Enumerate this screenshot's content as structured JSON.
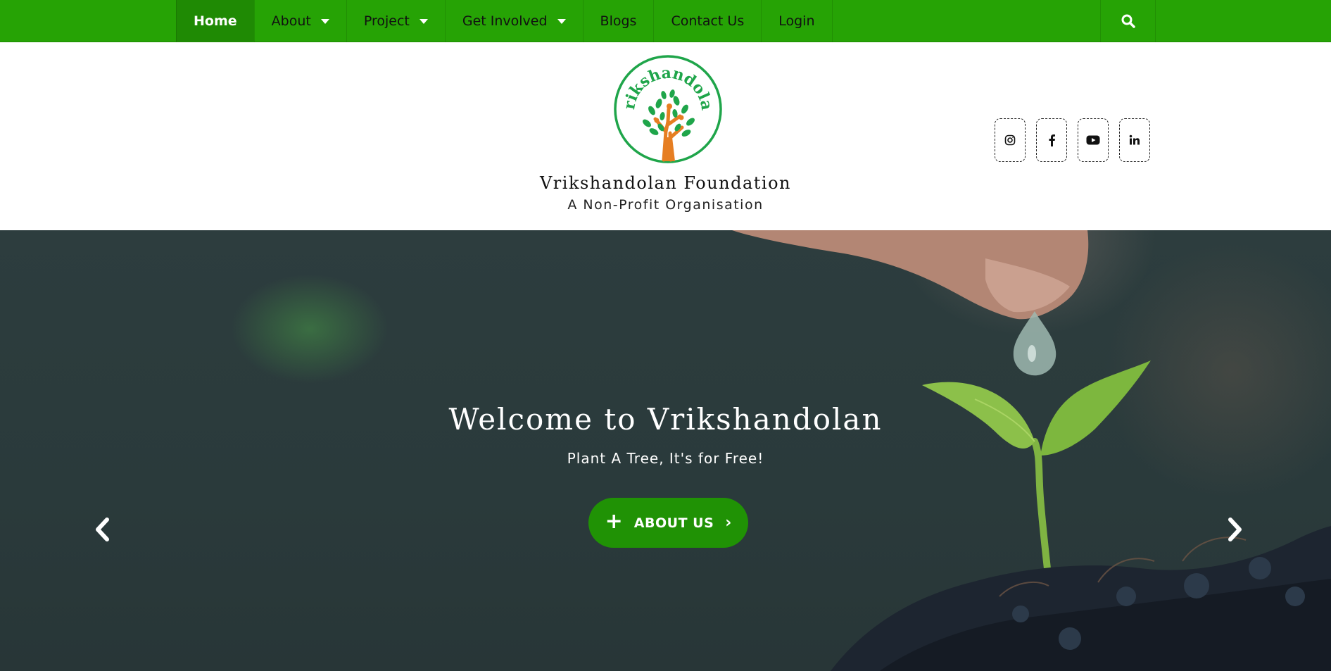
{
  "nav": {
    "items": [
      {
        "label": "Home",
        "active": true,
        "dropdown": false
      },
      {
        "label": "About",
        "active": false,
        "dropdown": true
      },
      {
        "label": "Project",
        "active": false,
        "dropdown": true
      },
      {
        "label": "Get Involved",
        "active": false,
        "dropdown": true
      },
      {
        "label": "Blogs",
        "active": false,
        "dropdown": false
      },
      {
        "label": "Contact Us",
        "active": false,
        "dropdown": false
      },
      {
        "label": "Login",
        "active": false,
        "dropdown": false
      }
    ],
    "search_icon": "search-icon"
  },
  "header": {
    "logo_text": "Vrikshandolan",
    "title": "Vrikshandolan Foundation",
    "subtitle": "A Non-Profit Organisation",
    "social": [
      {
        "icon": "instagram-icon",
        "glyph": "◎"
      },
      {
        "icon": "facebook-icon",
        "glyph": "f"
      },
      {
        "icon": "youtube-icon",
        "glyph": "▶"
      },
      {
        "icon": "linkedin-icon",
        "glyph": "in"
      }
    ]
  },
  "hero": {
    "title": "Welcome to Vrikshandolan",
    "subtitle": "Plant A Tree, It's for Free!",
    "button_label": "ABOUT US",
    "button_plus": "+",
    "button_chevron": "›",
    "prev_arrow": "‹",
    "next_arrow": "›"
  },
  "colors": {
    "nav_green": "#26a305",
    "nav_active": "#1f8a04",
    "button_green": "#209205",
    "logo_green": "#1fa54a",
    "logo_trunk": "#e67e22"
  }
}
